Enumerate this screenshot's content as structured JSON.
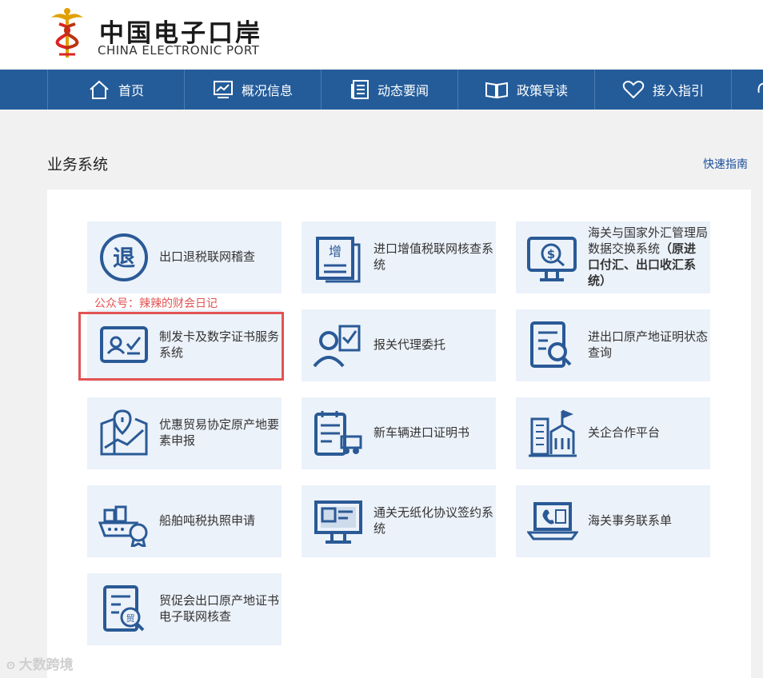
{
  "header": {
    "title": "中国电子口岸",
    "subtitle": "CHINA ELECTRONIC PORT"
  },
  "nav": [
    {
      "label": "首页",
      "icon": "home-icon"
    },
    {
      "label": "概况信息",
      "icon": "chart-icon"
    },
    {
      "label": "动态要闻",
      "icon": "news-icon"
    },
    {
      "label": "政策导读",
      "icon": "book-icon"
    },
    {
      "label": "接入指引",
      "icon": "heart-icon"
    }
  ],
  "section": {
    "title": "业务系统",
    "quick_guide": "快速指南"
  },
  "cards": [
    {
      "label": "出口退税联网稽查",
      "icon": "tax-refund-icon"
    },
    {
      "label": "进口增值税联网核查系统",
      "icon": "vat-document-icon"
    },
    {
      "label": "海关与国家外汇管理局数据交换系统（原进口付汇、出口收汇系统）",
      "label_plain": "海关与国家外汇管理局数据交换系统",
      "label_bold": "（原进口付汇、出口收汇系统）",
      "icon": "forex-monitor-icon"
    },
    {
      "label": "制发卡及数字证书服务系统",
      "icon": "id-card-icon"
    },
    {
      "label": "报关代理委托",
      "icon": "customs-agent-icon"
    },
    {
      "label": "进出口原产地证明状态查询",
      "icon": "origin-search-icon"
    },
    {
      "label": "优惠贸易协定原产地要素申报",
      "icon": "trade-map-icon"
    },
    {
      "label": "新车辆进口证明书",
      "icon": "vehicle-certificate-icon"
    },
    {
      "label": "关企合作平台",
      "icon": "enterprise-building-icon"
    },
    {
      "label": "船舶吨税执照申请",
      "icon": "ship-icon"
    },
    {
      "label": "通关无纸化协议签约系统",
      "icon": "paperless-screen-icon"
    },
    {
      "label": "海关事务联系单",
      "icon": "laptop-contact-icon"
    },
    {
      "label": "贸促会出口原产地证书电子联网核查",
      "icon": "trade-certificate-icon"
    }
  ],
  "watermark": "公众号：辣辣的财会日记",
  "corner_mark": "大数跨境",
  "colors": {
    "nav_bg": "#245c9a",
    "card_bg": "#ecf2fa",
    "icon_blue": "#2a5a96",
    "highlight_red": "#e35353",
    "link_blue": "#1b4f9c"
  }
}
